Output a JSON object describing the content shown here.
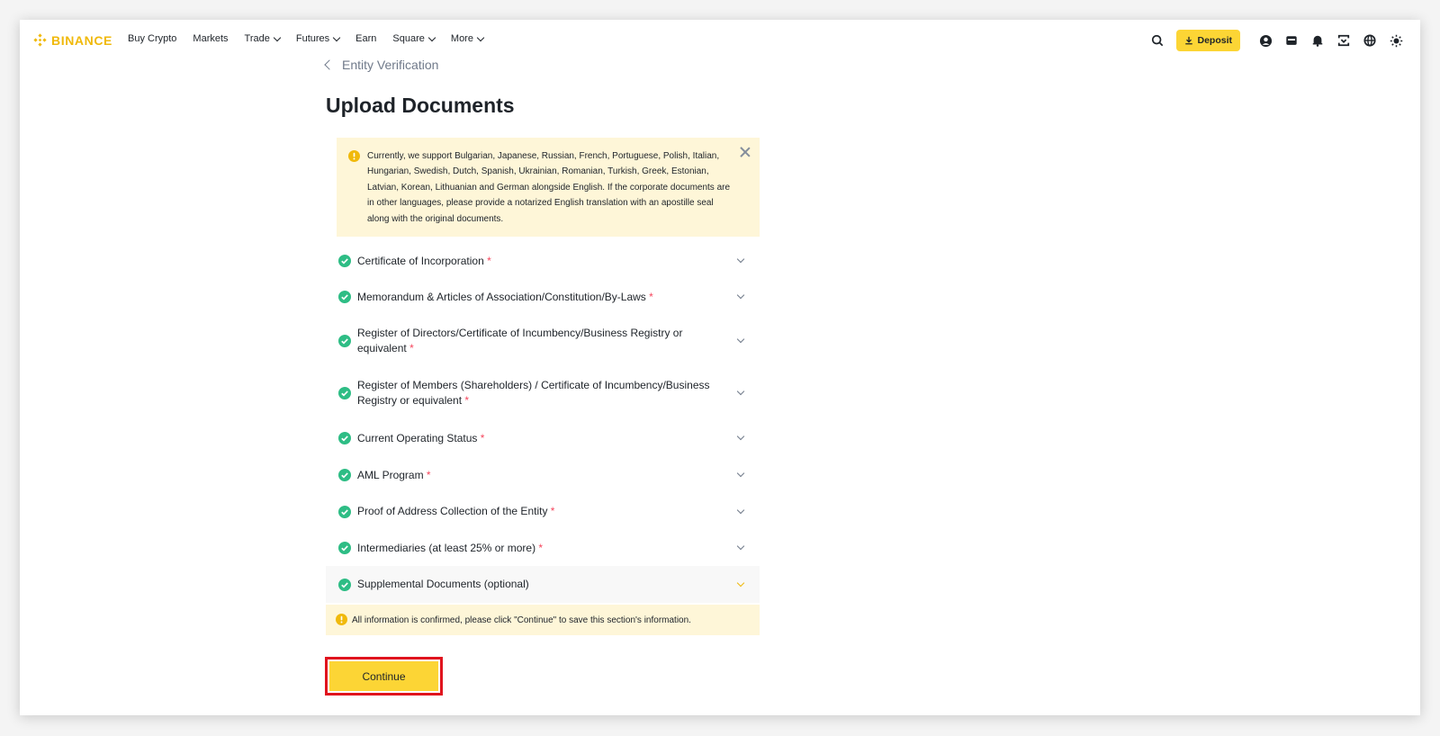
{
  "header": {
    "logo_text": "BINANCE",
    "nav": [
      {
        "label": "Buy Crypto",
        "has_dropdown": false
      },
      {
        "label": "Markets",
        "has_dropdown": false
      },
      {
        "label": "Trade",
        "has_dropdown": true
      },
      {
        "label": "Futures",
        "has_dropdown": true
      },
      {
        "label": "Earn",
        "has_dropdown": false
      },
      {
        "label": "Square",
        "has_dropdown": true
      },
      {
        "label": "More",
        "has_dropdown": true
      }
    ],
    "deposit_label": "Deposit",
    "icons": [
      "search-icon",
      "profile-icon",
      "wallet-icon",
      "bell-icon",
      "download-icon",
      "globe-icon",
      "theme-icon"
    ]
  },
  "breadcrumb": {
    "back_label": "Entity Verification"
  },
  "page": {
    "title": "Upload Documents"
  },
  "notice": {
    "text": "Currently, we support Bulgarian, Japanese, Russian, French, Portuguese, Polish, Italian, Hungarian, Swedish, Dutch, Spanish, Ukrainian, Romanian, Turkish, Greek, Estonian, Latvian, Korean, Lithuanian and German alongside English. If the corporate documents are in other languages, please provide a notarized English translation with an apostille seal along with the original documents."
  },
  "documents": [
    {
      "label": "Certificate of Incorporation",
      "required": "*",
      "status": "complete"
    },
    {
      "label": "Memorandum & Articles of Association/Constitution/By-Laws",
      "required": "*",
      "status": "complete"
    },
    {
      "label": "Register of Directors/Certificate of Incumbency/Business Registry or equivalent",
      "required": "*",
      "status": "complete"
    },
    {
      "label": "Register of Members (Shareholders) / Certificate of Incumbency/Business Registry or equivalent",
      "required": "*",
      "status": "complete"
    },
    {
      "label": "Current Operating Status",
      "required": "*",
      "status": "complete"
    },
    {
      "label": "AML Program",
      "required": "*",
      "status": "complete"
    },
    {
      "label": "Proof of Address Collection of the Entity",
      "required": "*",
      "status": "complete"
    },
    {
      "label": "Intermediaries (at least 25% or more)",
      "required": "*",
      "status": "complete"
    },
    {
      "label": "Supplemental Documents (optional)",
      "required": "",
      "status": "complete"
    }
  ],
  "info_bar": {
    "text": "All information is confirmed, please click \"Continue\" to save this section's information."
  },
  "actions": {
    "continue_label": "Continue"
  },
  "colors": {
    "brand": "#f0b90b",
    "button": "#fcd535",
    "success": "#2ebd85",
    "notice_bg": "#fef6d8",
    "required": "#f6465d",
    "highlight": "#e0141e"
  }
}
